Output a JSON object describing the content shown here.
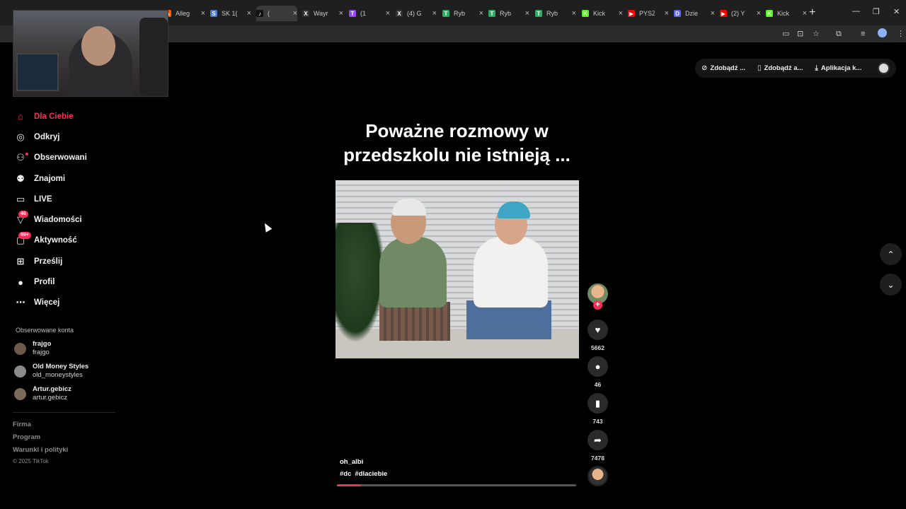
{
  "browser": {
    "tabs": [
      {
        "title": "Alleg",
        "fav_color": "#ff5a00",
        "fav_glyph": "A"
      },
      {
        "title": "SK 1(",
        "fav_color": "#4b7bd1",
        "fav_glyph": "S"
      },
      {
        "title": "(",
        "fav_color": "#111111",
        "fav_glyph": "♪",
        "active": true
      },
      {
        "title": "Wayr",
        "fav_color": "#333333",
        "fav_glyph": "X"
      },
      {
        "title": "(1",
        "fav_color": "#9146ff",
        "fav_glyph": "T"
      },
      {
        "title": "(4) G",
        "fav_color": "#333333",
        "fav_glyph": "X"
      },
      {
        "title": "Ryb",
        "fav_color": "#27ae60",
        "fav_glyph": "T"
      },
      {
        "title": "Ryb",
        "fav_color": "#27ae60",
        "fav_glyph": "T"
      },
      {
        "title": "Ryb",
        "fav_color": "#27ae60",
        "fav_glyph": "T"
      },
      {
        "title": "Kick",
        "fav_color": "#53fc18",
        "fav_glyph": "K"
      },
      {
        "title": "PYSZ",
        "fav_color": "#ff0000",
        "fav_glyph": "▶"
      },
      {
        "title": "Dzie",
        "fav_color": "#5865f2",
        "fav_glyph": "D"
      },
      {
        "title": "(2) Y",
        "fav_color": "#ff0000",
        "fav_glyph": "▶"
      },
      {
        "title": "Kick",
        "fav_color": "#53fc18",
        "fav_glyph": "K"
      }
    ],
    "new_tab": "+",
    "window_minimize": "—",
    "window_restore": "❐",
    "window_close": "✕"
  },
  "sidebar": {
    "items": [
      {
        "label": "Dla Ciebie",
        "icon": "home-icon",
        "glyph": "⌂",
        "active": true
      },
      {
        "label": "Odkryj",
        "icon": "compass-icon",
        "glyph": "◎"
      },
      {
        "label": "Obserwowani",
        "icon": "user-plus-icon",
        "glyph": "⚇"
      },
      {
        "label": "Znajomi",
        "icon": "friends-icon",
        "glyph": "⚉"
      },
      {
        "label": "LIVE",
        "icon": "live-icon",
        "glyph": "▭"
      },
      {
        "label": "Wiadomości",
        "icon": "message-icon",
        "glyph": "▽",
        "badge": "46"
      },
      {
        "label": "Aktywność",
        "icon": "activity-icon",
        "glyph": "▢",
        "badge": "99+"
      },
      {
        "label": "Prześlij",
        "icon": "upload-icon",
        "glyph": "⊞"
      },
      {
        "label": "Profil",
        "icon": "profile-icon",
        "glyph": "●"
      },
      {
        "label": "Więcej",
        "icon": "more-icon",
        "glyph": "⋯"
      }
    ],
    "followed_title": "Obserwowane konta",
    "accounts": [
      {
        "name": "frajgo",
        "username": "frajgo",
        "color": "#6b5a4a"
      },
      {
        "name": "Old Money Styles",
        "username": "old_moneystyles",
        "color": "#8a8a8a"
      },
      {
        "name": "Artur.gebicz",
        "username": "artur.gebicz",
        "color": "#7a6a5a"
      }
    ],
    "footer": [
      "Firma",
      "Program",
      "Warunki i polityki"
    ],
    "copyright": "© 2025 TikTok"
  },
  "top_actions": [
    {
      "label": "Zdobądź ...",
      "icon": "coin-icon",
      "glyph": "⊘"
    },
    {
      "label": "Zdobądź a...",
      "icon": "phone-icon",
      "glyph": "▯"
    },
    {
      "label": "Aplikacja k...",
      "icon": "download-icon",
      "glyph": "⤓"
    }
  ],
  "video": {
    "caption": "Poważne rozmowy w przedszkolu nie istnieją ...",
    "author": "oh_albi",
    "tags": [
      "#dc",
      "#dlaciebie"
    ],
    "progress": 0.1
  },
  "actions": {
    "likes": "5662",
    "comments": "46",
    "saves": "743",
    "shares": "7478",
    "follow_plus": "+"
  },
  "nav_arrows": {
    "up": "⌃",
    "down": "⌄"
  },
  "colors": {
    "accent": "#fe2c55",
    "background": "#000000"
  }
}
